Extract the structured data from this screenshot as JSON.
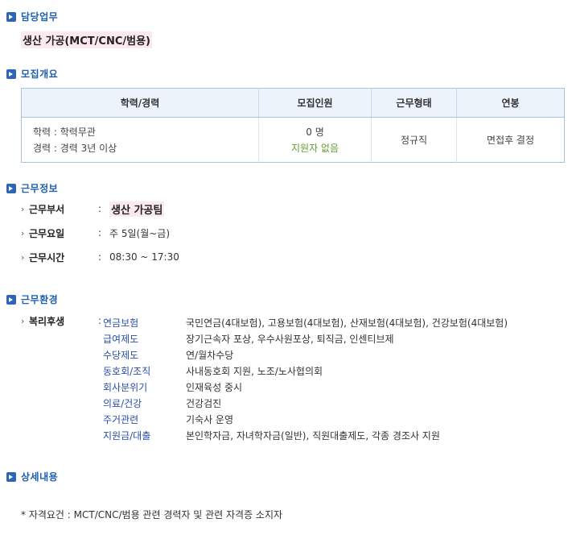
{
  "sections": {
    "duty": "담당업무",
    "overview": "모집개요",
    "work_info": "근무정보",
    "environment": "근무환경",
    "detail": "상세내용"
  },
  "job_title": "생산 가공(MCT/CNC/범용)",
  "table": {
    "headers": [
      "학력/경력",
      "모집인원",
      "근무형태",
      "연봉"
    ],
    "education_line": "학력 : 학력무관",
    "career_line": "경력 : 경력 3년 이상",
    "headcount": "0 명",
    "applicants": "지원자 없음",
    "employment_type": "정규직",
    "salary": "면접후 결정"
  },
  "work": {
    "dept_label": "근무부서",
    "dept_value": "생산 가공팀",
    "days_label": "근무요일",
    "days_value": "주 5일(월~금)",
    "hours_label": "근무시간",
    "hours_value": "08:30 ~ 17:30"
  },
  "welfare": {
    "label": "복리후생",
    "items": [
      {
        "category": "연금보험",
        "value": "국민연금(4대보험), 고용보험(4대보험), 산재보험(4대보험), 건강보험(4대보험)"
      },
      {
        "category": "급여제도",
        "value": "장기근속자 포상, 우수사원포상, 퇴직금, 인센티브제"
      },
      {
        "category": "수당제도",
        "value": "연/월차수당"
      },
      {
        "category": "동호회/조직",
        "value": "사내동호회 지원, 노조/노사협의회"
      },
      {
        "category": "회사분위기",
        "value": "인재육성 중시"
      },
      {
        "category": "의료/건강",
        "value": "건강검진"
      },
      {
        "category": "주거관련",
        "value": "기숙사 운영"
      },
      {
        "category": "지원금/대출",
        "value": "본인학자금, 자녀학자금(일반), 직원대출제도, 각종 경조사 지원"
      }
    ]
  },
  "detail_text": "* 자격요건 : MCT/CNC/범용 관련 경력자 및 관련 자격증 소지자",
  "colon": ":",
  "colors": {
    "accent": "#1c5fae",
    "category": "#2a4fa8",
    "highlight": "#fbe9ef",
    "applicant": "#66a032"
  }
}
